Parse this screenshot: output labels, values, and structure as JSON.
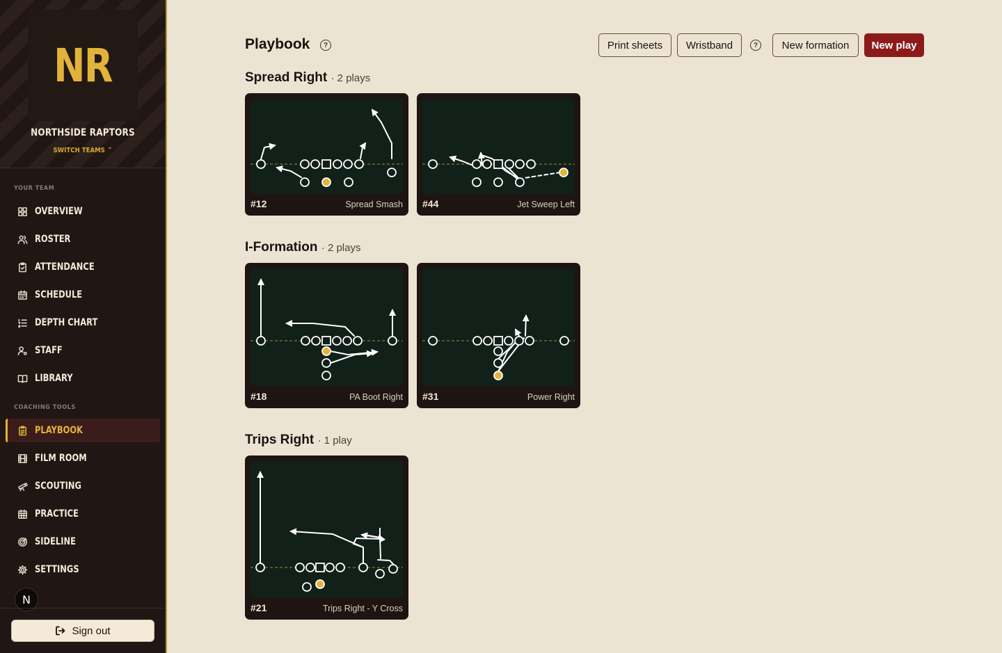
{
  "sidebar": {
    "logo_text": "NR",
    "team_name": "NORTHSIDE RAPTORS",
    "switch_teams": "SWITCH TEAMS",
    "section_team": "YOUR TEAM",
    "section_tools": "COACHING TOOLS",
    "items": [
      {
        "label": "OVERVIEW",
        "icon": "grid-icon"
      },
      {
        "label": "ROSTER",
        "icon": "users-icon"
      },
      {
        "label": "ATTENDANCE",
        "icon": "clipboard-check-icon"
      },
      {
        "label": "SCHEDULE",
        "icon": "calendar-icon"
      },
      {
        "label": "DEPTH CHART",
        "icon": "list-ordered-icon"
      },
      {
        "label": "STAFF",
        "icon": "user-cog-icon"
      },
      {
        "label": "LIBRARY",
        "icon": "book-icon"
      },
      {
        "label": "PLAYBOOK",
        "icon": "clipboard-icon",
        "active": true
      },
      {
        "label": "FILM ROOM",
        "icon": "film-icon"
      },
      {
        "label": "SCOUTING",
        "icon": "telescope-icon"
      },
      {
        "label": "PRACTICE",
        "icon": "calendar-grid-icon"
      },
      {
        "label": "SIDELINE",
        "icon": "target-icon"
      },
      {
        "label": "SETTINGS",
        "icon": "gear-icon"
      }
    ],
    "avatar_letter": "N",
    "sign_out": "Sign out"
  },
  "header": {
    "title": "Playbook",
    "help": "?",
    "buttons": {
      "print_sheets": "Print sheets",
      "wristband": "Wristband",
      "new_formation": "New formation",
      "new_play": "New play"
    }
  },
  "colors": {
    "accent_gold": "#e2b33a",
    "primary_red": "#8b1b1b",
    "field_green": "#112019",
    "sidebar_bg": "#201613"
  },
  "formations": [
    {
      "name": "Spread Right",
      "count": "· 2 plays",
      "plays": [
        {
          "number": "#12",
          "name": "Spread Smash"
        },
        {
          "number": "#44",
          "name": "Jet Sweep Left"
        }
      ]
    },
    {
      "name": "I-Formation",
      "count": "· 2 plays",
      "plays": [
        {
          "number": "#18",
          "name": "PA Boot Right"
        },
        {
          "number": "#31",
          "name": "Power Right"
        }
      ]
    },
    {
      "name": "Trips Right",
      "count": "· 1 play",
      "plays": [
        {
          "number": "#21",
          "name": "Trips Right - Y Cross"
        }
      ]
    }
  ]
}
